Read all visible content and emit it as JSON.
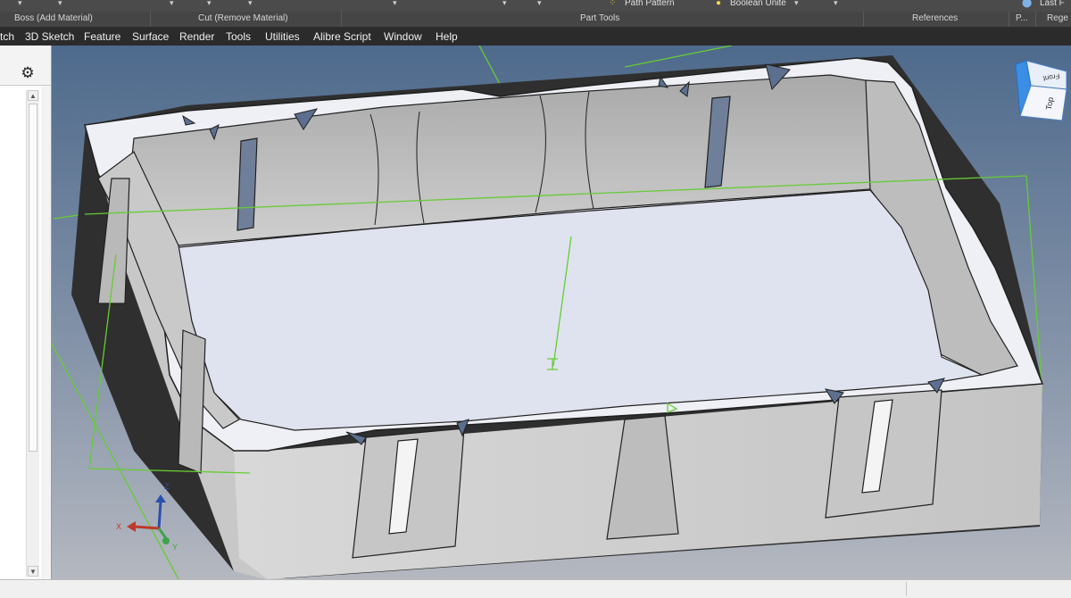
{
  "ribbon_top": {
    "path_pattern": "Path Pattern",
    "boolean_union": "Boolean Unite",
    "last_feature": "Last F"
  },
  "ribbon_groups": {
    "boss": "Boss (Add Material)",
    "cut": "Cut (Remove Material)",
    "part_tools": "Part Tools",
    "references": "References",
    "p": "P...",
    "regen": "Rege"
  },
  "menu": {
    "sketch": "tch",
    "sketch3d": "3D Sketch",
    "feature": "Feature",
    "surface": "Surface",
    "render": "Render",
    "tools": "Tools",
    "utilities": "Utilities",
    "alibre_script": "Alibre Script",
    "window": "Window",
    "help": "Help"
  },
  "panel": {
    "settings_icon": "gear-icon"
  },
  "viewport": {
    "background_top": "#4e6a8c",
    "background_bottom": "#b4b8c0",
    "plane_color": "#66cc33",
    "viewcube": {
      "front": "Front",
      "top": "Top"
    },
    "triad": {
      "x": "X",
      "y": "Y",
      "z": "Z",
      "x_color": "#c0392b",
      "y_color": "#3fa34d",
      "z_color": "#2b4fb0"
    }
  }
}
